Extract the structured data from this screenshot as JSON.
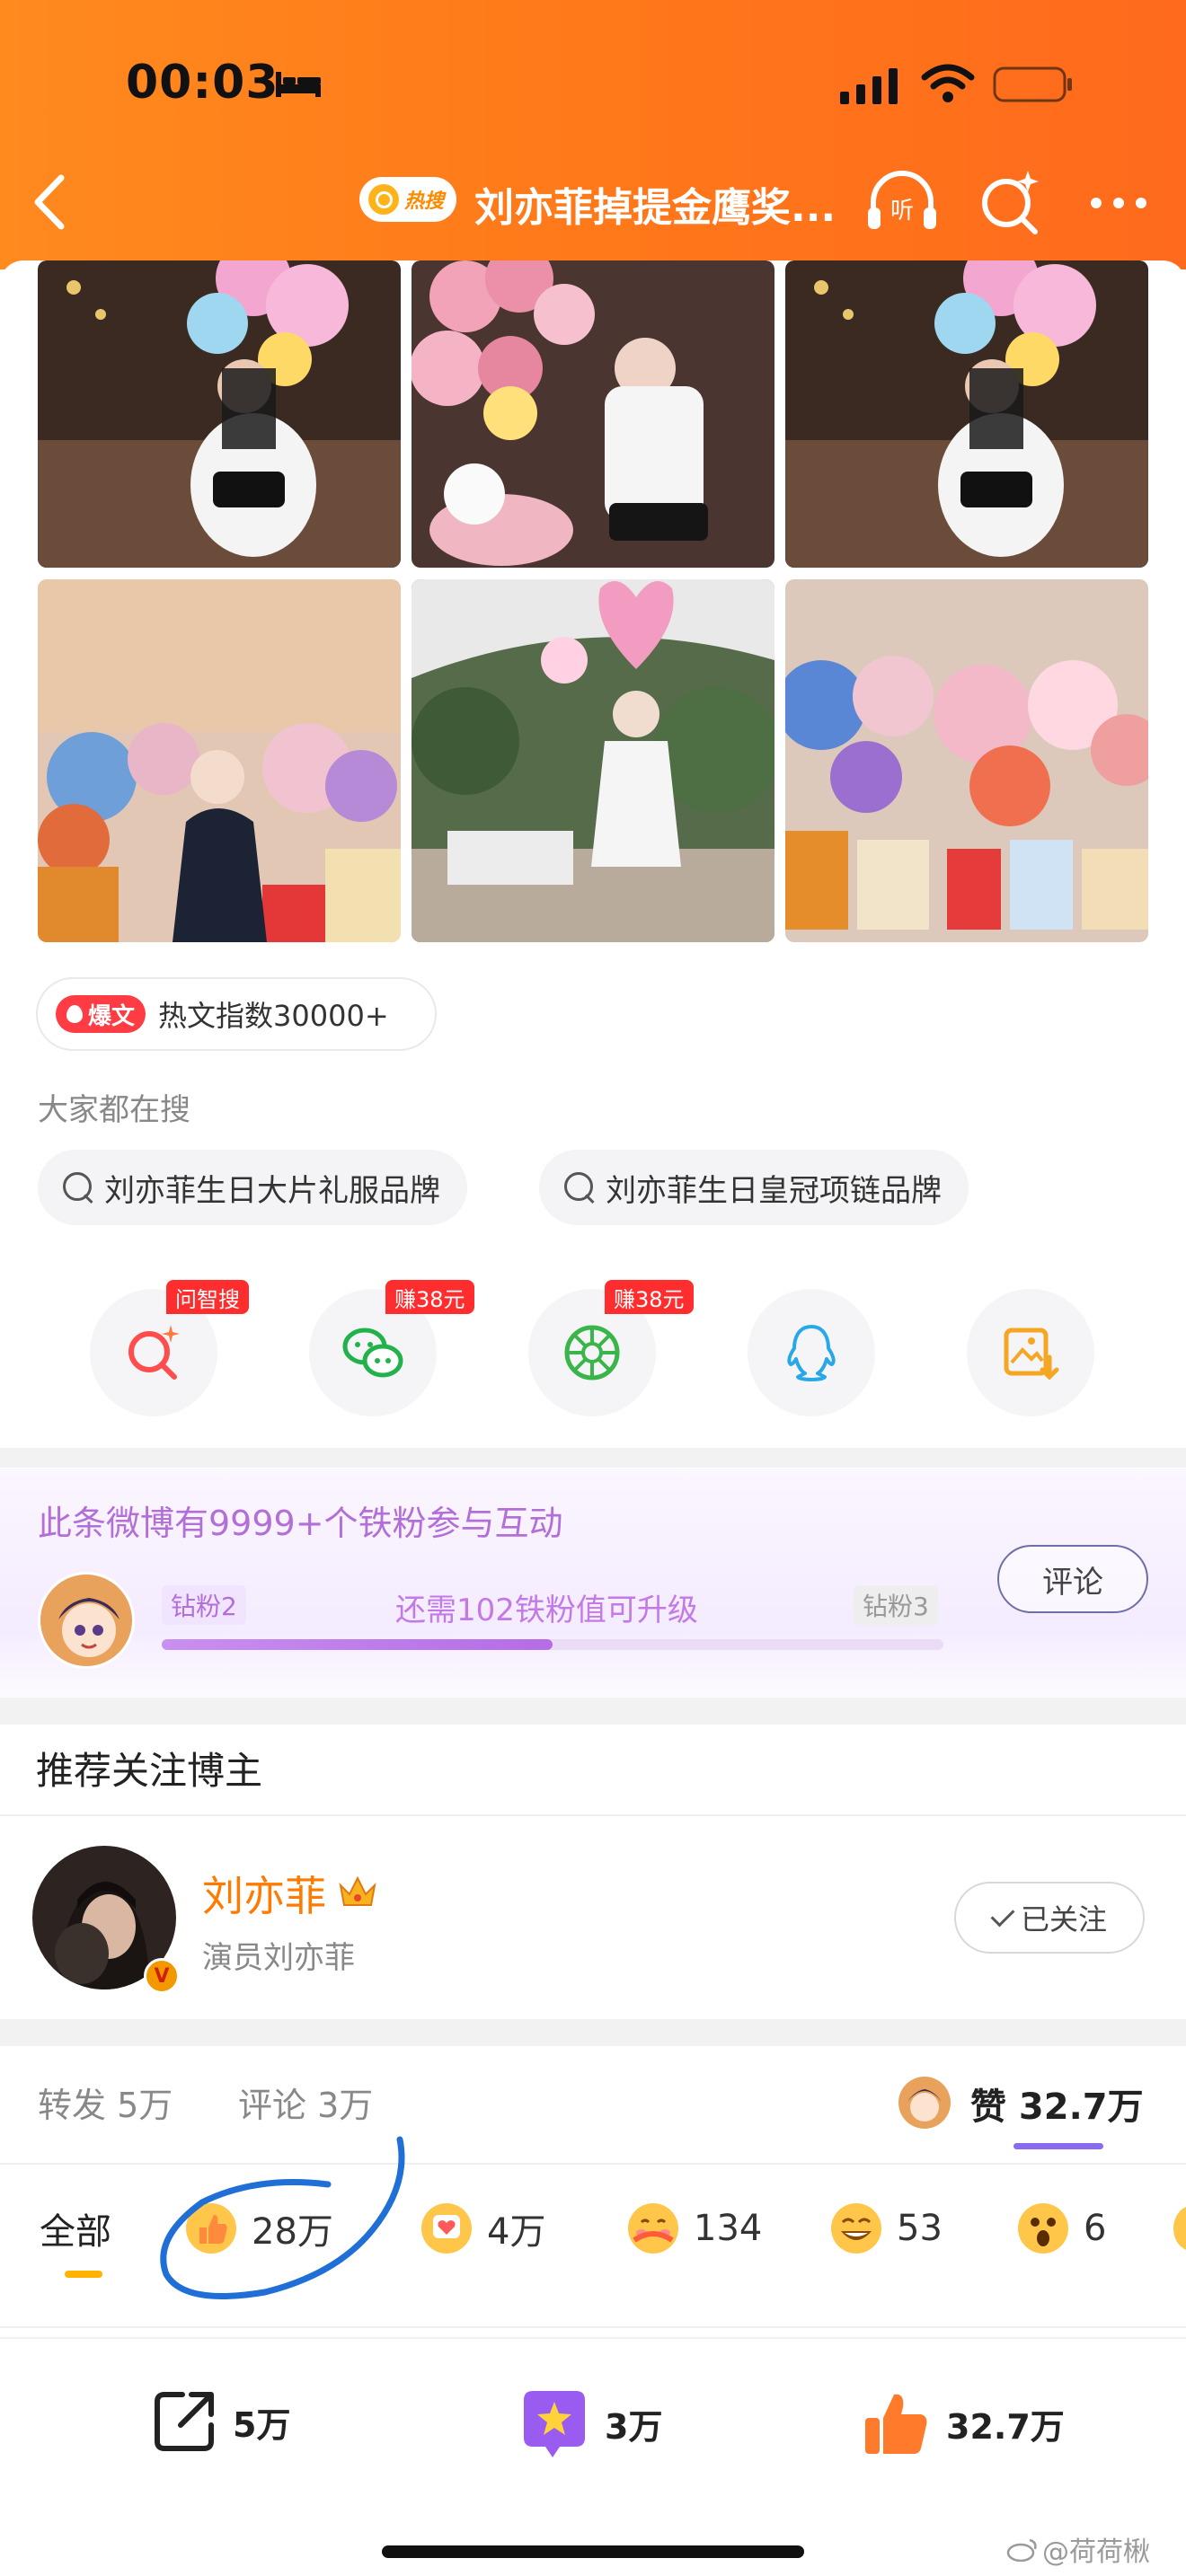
{
  "status_bar": {
    "time": "00:03"
  },
  "header": {
    "hot_tag": "热搜",
    "title": "刘亦菲掉提金鹰奖..."
  },
  "hot_index": {
    "badge": "爆文",
    "text": "热文指数30000+"
  },
  "search_section": {
    "label": "大家都在搜",
    "chips": [
      "刘亦菲生日大片礼服品牌",
      "刘亦菲生日皇冠项链品牌"
    ]
  },
  "share_row": {
    "badges": [
      "问智搜",
      "赚38元",
      "赚38元"
    ],
    "icons": [
      "ai-search-icon",
      "wechat-icon",
      "moments-icon",
      "qq-icon",
      "save-image-icon"
    ]
  },
  "fans_card": {
    "title": "此条微博有9999+个铁粉参与互动",
    "level_left": "钻粉2",
    "level_right": "钻粉3",
    "need_text": "还需102铁粉值可升级",
    "progress": 0.5,
    "comment_button": "评论"
  },
  "recommend": {
    "title": "推荐关注博主",
    "name": "刘亦菲",
    "desc": "演员刘亦菲",
    "follow_label": "已关注",
    "verified": "V"
  },
  "stats": {
    "repost": "转发 5万",
    "comment": "评论 3万",
    "likes": "赞 32.7万"
  },
  "reactions": {
    "all": "全部",
    "items": [
      {
        "icon": "thumbs-up-icon",
        "count": "28万"
      },
      {
        "icon": "heart-card-icon",
        "count": "4万"
      },
      {
        "icon": "hug-icon",
        "count": "134"
      },
      {
        "icon": "laugh-icon",
        "count": "53"
      },
      {
        "icon": "surprised-icon",
        "count": "6"
      }
    ]
  },
  "bottom_bar": {
    "repost": "5万",
    "comment": "3万",
    "like": "32.7万"
  },
  "watermark": "@荷荷楸",
  "colors": {
    "header_orange": "#ff7a1a",
    "accent_purple": "#b36fd8",
    "name_orange": "#ff7a00",
    "annotation_blue": "#1f6fd6"
  }
}
